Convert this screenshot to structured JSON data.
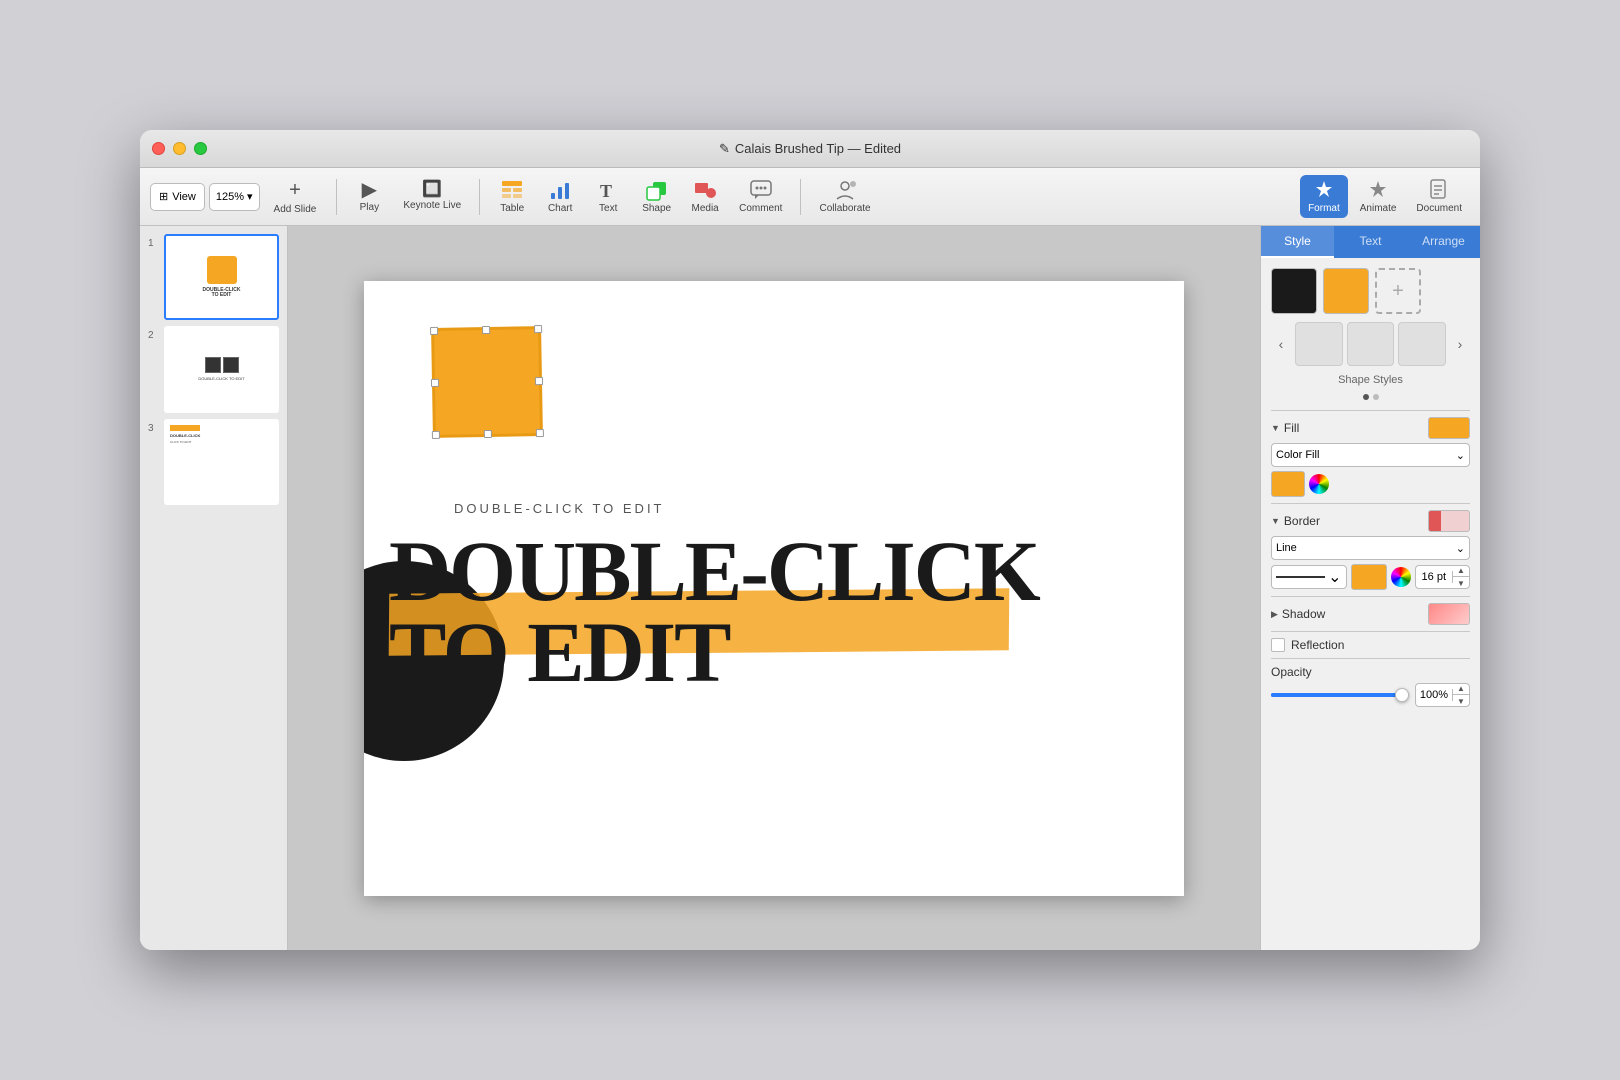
{
  "window": {
    "title": "Calais Brushed Tip — Edited"
  },
  "toolbar": {
    "view_label": "View",
    "zoom_value": "125%",
    "add_slide_label": "Add Slide",
    "play_label": "Play",
    "keynote_live_label": "Keynote Live",
    "table_label": "Table",
    "chart_label": "Chart",
    "text_label": "Text",
    "shape_label": "Shape",
    "media_label": "Media",
    "comment_label": "Comment",
    "collaborate_label": "Collaborate",
    "format_label": "Format",
    "animate_label": "Animate",
    "document_label": "Document"
  },
  "slides": [
    {
      "num": "1",
      "active": true
    },
    {
      "num": "2",
      "active": false
    },
    {
      "num": "3",
      "active": false
    }
  ],
  "slide": {
    "small_text": "DOUBLE-CLICK TO EDIT",
    "main_text_line1": "DOUBLE-CLICK",
    "main_text_line2": "TO EDIT"
  },
  "right_panel": {
    "tabs": [
      "Style",
      "Text",
      "Arrange"
    ],
    "active_tab": "Style",
    "shape_styles_label": "Shape Styles",
    "fill_label": "Fill",
    "fill_color": "#f5a623",
    "fill_type": "Color Fill",
    "border_label": "Border",
    "border_type": "Line",
    "border_size": "16 pt",
    "shadow_label": "Shadow",
    "reflection_label": "Reflection",
    "opacity_label": "Opacity",
    "opacity_value": "100%"
  }
}
